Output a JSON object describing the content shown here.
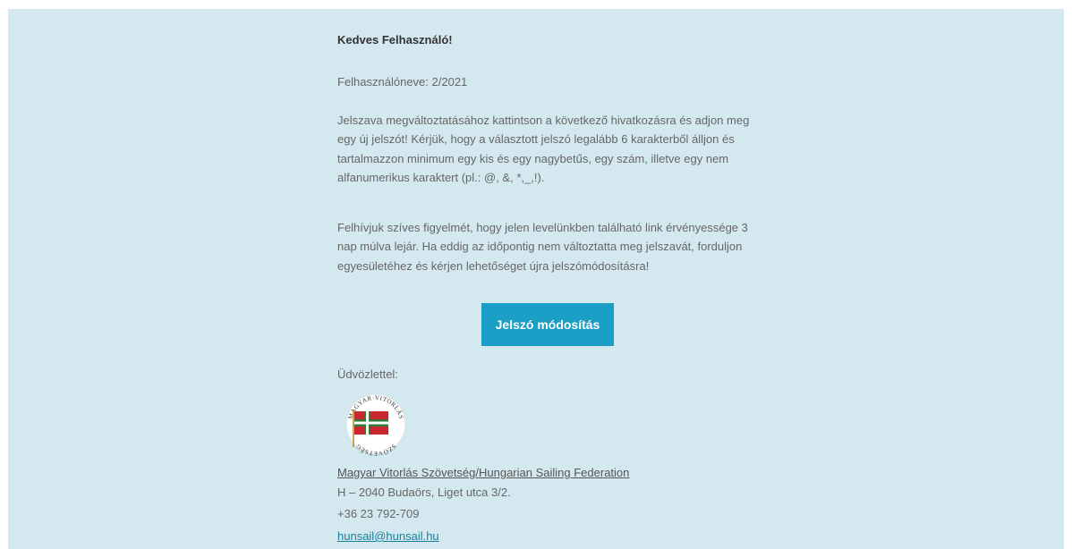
{
  "email": {
    "greeting": "Kedves Felhasználó!",
    "username_line": "Felhasználóneve: 2/2021",
    "paragraph1": "Jelszava megváltoztatásához kattintson a következő hivatkozásra és adjon meg egy új jelszót! Kérjük, hogy a választott jelszó legalább 6 karakterből álljon és tartalmazzon minimum egy kis és egy nagybetűs, egy szám, illetve egy nem alfanumerikus karaktert (pl.: @, &, *,_,!).",
    "paragraph2": "Felhívjuk szíves figyelmét, hogy jelen levelünkben található link érvényessége 3 nap múlva lejár. Ha eddig az időpontig nem változtatta meg jelszavát, forduljon egyesületéhez és kérjen lehetőséget újra jelszómódosításra!",
    "button_label": "Jelszó módosítás",
    "closing": "Üdvözlettel:",
    "logo_text": "MAGYAR VITORLÁS SZÖVETSÉG",
    "organization": "Magyar Vitorlás Szövetség/Hungarian Sailing Federation",
    "address": "H – 2040 Budaörs, Liget utca 3/2.",
    "phone": "+36 23 792-709",
    "email_address": "hunsail@hunsail.hu"
  },
  "colors": {
    "background": "#d4e9ef",
    "button": "#1c9fc7",
    "link": "#1a7f9a"
  }
}
